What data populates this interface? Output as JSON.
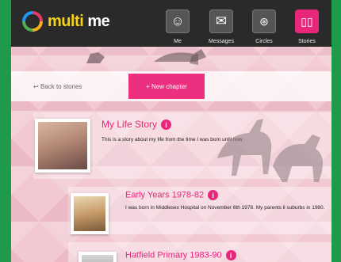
{
  "app": {
    "logo_text_multi": "multi",
    "logo_text_me": " me"
  },
  "nav": {
    "me": "Me",
    "messages": "Messages",
    "circles": "Circles",
    "stories": "Stories"
  },
  "toolbar": {
    "back": "Back to stories",
    "new_chapter": "+ New chapter"
  },
  "story": {
    "title": "My Life Story",
    "description": "This is a story about my life from the time I was born until now"
  },
  "chapters": [
    {
      "title": "Early Years 1978-82",
      "description": "I was born in Middlesex Hospital on November 6th 1978. My parents li suburbs in 1980."
    },
    {
      "title": "Hatfield Primary 1983-90",
      "description": ""
    }
  ],
  "colors": {
    "accent": "#e8267a",
    "header_bg": "#2a2a2a",
    "outer_bg": "#1f9a4a"
  }
}
